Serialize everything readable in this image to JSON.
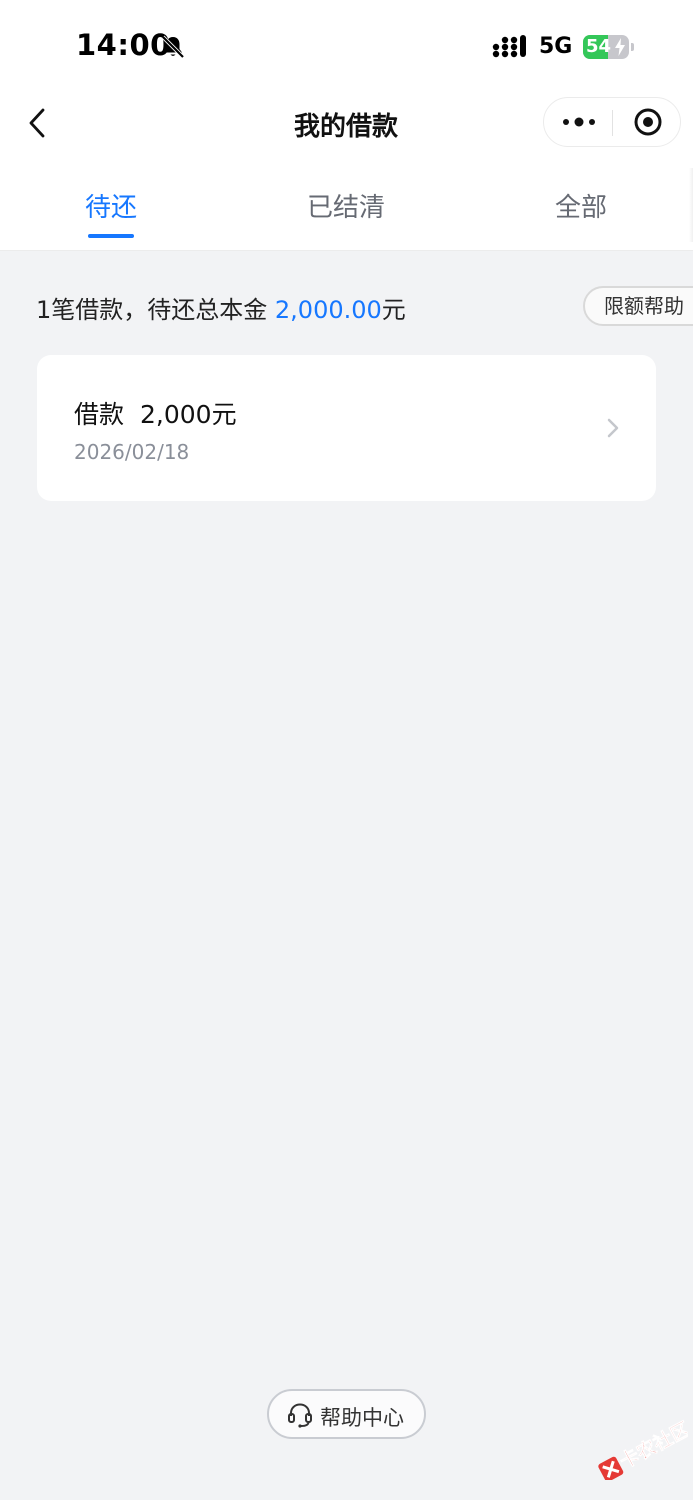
{
  "status_bar": {
    "time": "14:00",
    "network": "5G",
    "battery_level": "54",
    "battery_fraction": 0.54,
    "icons": [
      "bell-muted-icon",
      "signal-icon",
      "battery-charging-icon"
    ]
  },
  "nav": {
    "title": "我的借款",
    "back_icon": "chevron-left-icon",
    "more_icon": "more-dots-icon",
    "close_icon": "target-circle-icon"
  },
  "tabs": [
    {
      "label": "待还",
      "active": true
    },
    {
      "label": "已结清",
      "active": false
    },
    {
      "label": "全部",
      "active": false
    }
  ],
  "summary": {
    "prefix": "1笔借款，待还总本金 ",
    "amount": "2,000.00",
    "suffix": "元",
    "help_button": "限额帮助"
  },
  "loans": [
    {
      "label": "借款",
      "amount": "2,000元",
      "date": "2026/02/18"
    }
  ],
  "footer": {
    "help_center": "帮助中心",
    "help_icon": "headset-icon"
  },
  "watermark": {
    "text": "卡农社区"
  },
  "colors": {
    "accent": "#1677ff",
    "background": "#f2f3f5",
    "battery_green": "#34c759"
  }
}
